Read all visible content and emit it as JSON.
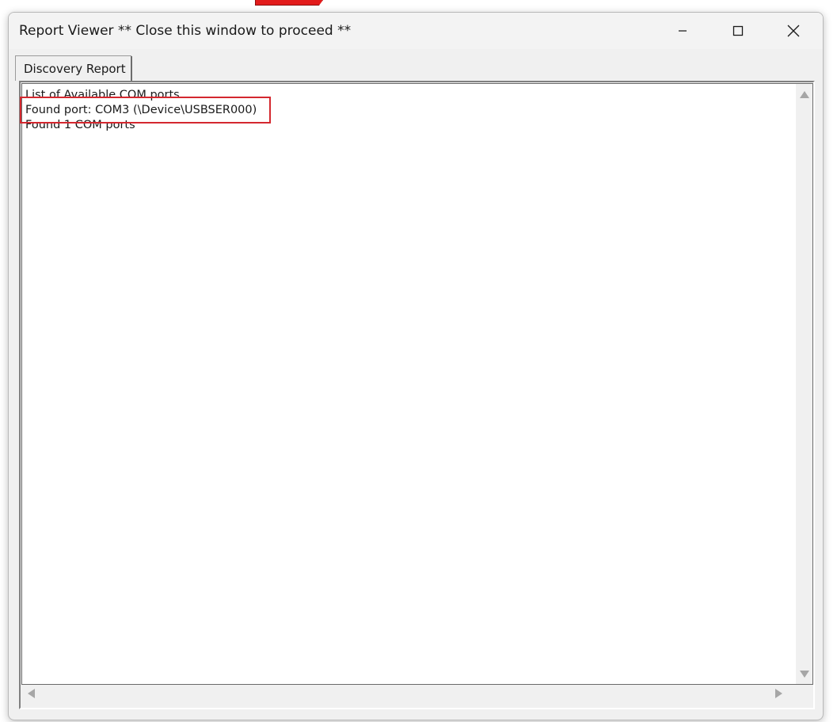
{
  "window": {
    "title": "Report Viewer ** Close this window to proceed **",
    "controls": {
      "minimize_icon": "minimize-icon",
      "maximize_icon": "maximize-icon",
      "close_icon": "close-icon"
    }
  },
  "tabs": [
    {
      "label": "Discovery Report",
      "selected": true
    }
  ],
  "report": {
    "lines": [
      "List of Available COM ports",
      "Found port: COM3   (\\Device\\USBSER000)",
      "Found 1 COM ports"
    ],
    "highlighted_line_index": 1
  },
  "colors": {
    "highlight_border": "#d4282f",
    "window_background": "#f0f0f0",
    "text_area_background": "#ffffff",
    "top_fragment": "#e21b1b"
  }
}
